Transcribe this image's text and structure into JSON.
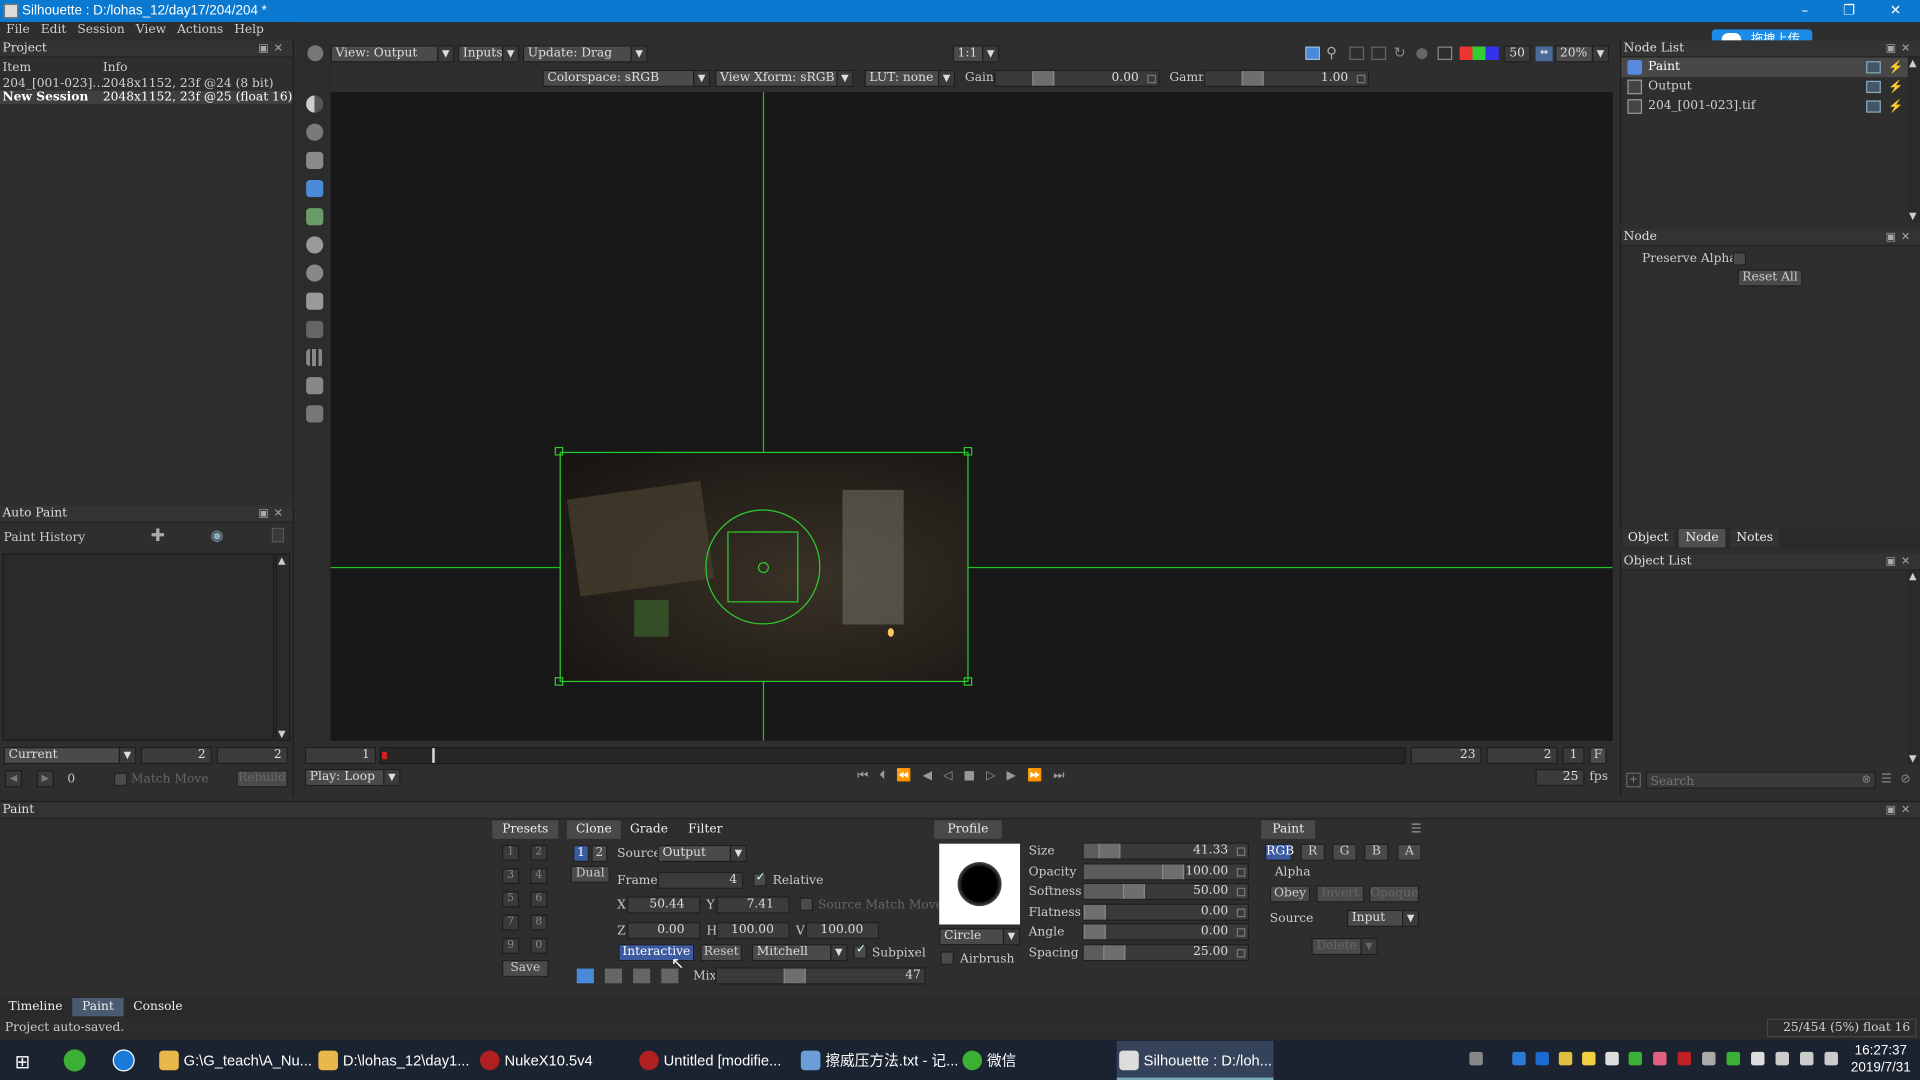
{
  "window": {
    "title": "Silhouette : D:/lohas_12/day17/204/204 *",
    "minimize": "–",
    "maximize": "❐",
    "close": "✕"
  },
  "overlay_badge": "拖拽上传",
  "menu": [
    "File",
    "Edit",
    "Session",
    "View",
    "Actions",
    "Help"
  ],
  "project": {
    "title": "Project",
    "columns": [
      "Item",
      "Info"
    ],
    "rows": [
      {
        "item": "204_[001-023]…",
        "info": "2048x1152, 23f @24 (8 bit)"
      },
      {
        "item": "New Session",
        "info": "2048x1152, 23f @25 (float 16)"
      }
    ]
  },
  "viewer": {
    "view": "View: Output",
    "inputs": "Inputs",
    "update": "Update: Drag",
    "ratio": "1:1",
    "colorspace": "Colorspace: sRGB",
    "view_xform": "View Xform: sRGB",
    "lut": "LUT: none",
    "gain_label": "Gain",
    "gain_value": "0.00",
    "gamma_label": "Gamma",
    "gamma_value": "1.00",
    "quality": "50",
    "zoom": "20%"
  },
  "timeline": {
    "start": "1",
    "end": "23",
    "current": "2",
    "step": "1",
    "f_button": "F",
    "play_mode": "Play: Loop",
    "fps_value": "25",
    "fps_label": "fps",
    "progress": 0.05
  },
  "autopaint": {
    "title": "Auto Paint",
    "history_label": "Paint History",
    "mode": "Current",
    "field_a": "2",
    "field_b": "2",
    "counter": "0",
    "match_move": "Match Move",
    "rebuild": "Rebuild"
  },
  "node_list": {
    "title": "Node List",
    "items": [
      "Paint",
      "Output",
      "204_[001-023].tif"
    ]
  },
  "node_panel": {
    "title": "Node",
    "preserve_alpha": "Preserve Alpha",
    "reset_all": "Reset All"
  },
  "right_tabs": [
    "Object",
    "Node",
    "Notes"
  ],
  "object_list": {
    "title": "Object List",
    "search_placeholder": "Search"
  },
  "paint": {
    "title": "Paint",
    "presets_tab": "Presets",
    "preset_numbers": [
      "1",
      "2",
      "3",
      "4",
      "5",
      "6",
      "7",
      "8",
      "9",
      "0"
    ],
    "save": "Save",
    "tabs": [
      "Clone",
      "Grade",
      "Filter"
    ],
    "clone": {
      "page1": "1",
      "page2": "2",
      "dual": "Dual",
      "source_label": "Source",
      "source_value": "Output",
      "frame_label": "Frame",
      "frame_value": "4",
      "relative_label": "Relative",
      "source_match_move": "Source Match Move",
      "x_label": "X",
      "x_value": "50.44",
      "y_label": "Y",
      "y_value": "7.41",
      "z_label": "Z",
      "z_value": "0.00",
      "h_label": "H",
      "h_value": "100.00",
      "v_label": "V",
      "v_value": "100.00",
      "interactive": "Interactive",
      "reset": "Reset",
      "filter": "Mitchell",
      "subpixel": "Subpixel",
      "mix_label": "Mix",
      "mix_value": "47"
    },
    "profile": {
      "tab": "Profile",
      "shape": "Circle",
      "airbrush": "Airbrush",
      "params": [
        {
          "label": "Size",
          "value": "41.33",
          "level": 0.18
        },
        {
          "label": "Opacity",
          "value": "100.00",
          "level": 1.0
        },
        {
          "label": "Softness",
          "value": "50.00",
          "level": 0.5
        },
        {
          "label": "Flatness",
          "value": "0.00",
          "level": 0.0
        },
        {
          "label": "Angle",
          "value": "0.00",
          "level": 0.0
        },
        {
          "label": "Spacing",
          "value": "25.00",
          "level": 0.25
        }
      ]
    },
    "paint_box": {
      "tab": "Paint",
      "channels": [
        "RGB",
        "R",
        "G",
        "B",
        "A"
      ],
      "alpha_label": "Alpha",
      "alpha_buttons": [
        "Obey",
        "Invert",
        "Opaque"
      ],
      "source_label": "Source",
      "source_value": "Input",
      "delete": "Delete"
    }
  },
  "bottom_tabs": [
    "Timeline",
    "Paint",
    "Console"
  ],
  "status": {
    "left": "Project auto-saved.",
    "right": "25/454 (5%) float 16"
  },
  "taskbar": {
    "items": [
      {
        "label": "G:\\G_teach\\A_Nu...",
        "color": "#e8b84a"
      },
      {
        "label": "D:\\lohas_12\\day1...",
        "color": "#e8b84a"
      },
      {
        "label": "NukeX10.5v4",
        "color": "#b02020"
      },
      {
        "label": "Untitled [modifie...",
        "color": "#b02020"
      },
      {
        "label": "擦威压方法.txt - 记...",
        "color": "#6a9ed8"
      },
      {
        "label": "微信",
        "color": "#3cb034"
      },
      {
        "label": "Silhouette : D:/loh...",
        "color": "#dddddd"
      }
    ],
    "time": "16:27:37",
    "date": "2019/7/31"
  }
}
